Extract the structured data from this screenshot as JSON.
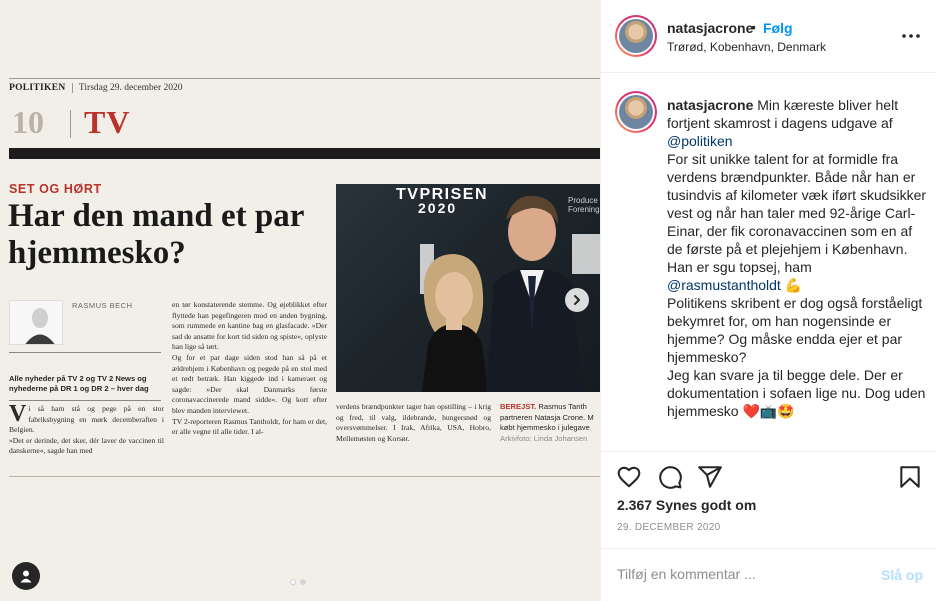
{
  "newspaper": {
    "brand": "POLITIKEN",
    "date": "Tirsdag 29. december 2020",
    "page_number": "10",
    "section": "TV",
    "kicker": "SET OG HØRT",
    "headline": "Har den mand et par hjemmesko?",
    "byline": "RASMUS BECH",
    "teaser": "Alle nyheder på TV 2 og TV 2 News og nyhederne på DR 1 og DR 2 – hver dag",
    "col1_dropcap": "V",
    "col1": "i så ham stå og pege på en stor fabriksbygning en mørk decemberaften i Belgien.\n»Det er derinde, det sker, dér laver de vaccinen til danskerne«, sagde han med",
    "col2": "en tør konstaterende stemme. Og øjeblikket efter flyttede han pegefingeren mod en anden bygning, som rummede en kantine bag en glasfacade. »Der sad de ansatte for kort tid siden og spiste«, oplyste han lige så tørt.\nOg for et par dage siden stod han så på et ældrehjem i København og pegede på en stol med et rødt betræk. Han kiggede ind i kameraet og sagde: »Der skal Danmarks første coronavaccinerede mand sidde«. Og kort efter blev manden interviewet.\nTV 2-reporteren Rasmus Tantholdt, for ham er det, er alle vegne til alle tider. I al-",
    "col3": "verdens brændpunkter tager han opstilling – i krig og fred, til valg, ildebrande, hungersnød og oversvømmelser. I Irak, Afrika, USA, Hobro, Mellemøsten og Korsør.",
    "caption_label": "BEREJST.",
    "caption_text": "Rasmus Tanth partneren Natasja Crone. M købt hjemmesko i julegave",
    "caption_credit": "Arkivfoto: Linda Johansen",
    "photo_text_line1": "TVPRISEN",
    "photo_text_line2": "2020",
    "photo_text_side": "Produce\nForenings"
  },
  "post": {
    "username": "natasjacrone",
    "separator": "•",
    "follow_label": "Følg",
    "location": "Trørød, Kobenhavn, Denmark",
    "caption_p1": " Min kæreste bliver helt fortjent skamrost i dagens udgave af ",
    "mention1": "@politiken",
    "caption_p2": "\nFor sit unikke talent for at formidle fra verdens brændpunkter. Både når han er tusindvis af kilometer væk iført skudsikker vest og når han taler med 92-årige Carl-Einar, der fik coronavaccinen som en af de første på et plejehjem i København.\nHan er sgu topsej, ham\n",
    "mention2": "@rasmustantholdt",
    "caption_p3": " 💪\nPolitikens skribent er dog også forståeligt bekymret for, om han nogensinde er hjemme? Og måske endda ejer et par hjemmesko?\nJeg kan svare ja til begge dele. Der er dokumentation i sofaen lige nu. Dog uden hjemmesko ❤️📺🤩",
    "likes": "2.367 Synes godt om",
    "date": "29. DECEMBER 2020",
    "comment_placeholder": "Tilføj en kommentar ...",
    "post_label": "Slå op"
  },
  "icons": [
    "more-icon",
    "heart-icon",
    "comment-icon",
    "share-icon",
    "bookmark-icon",
    "chevron-right-icon",
    "user-tag-icon"
  ],
  "colors": {
    "accent": "#0095f6",
    "newspaper_red": "#b8332b",
    "post_disabled": "#b2dffc"
  }
}
